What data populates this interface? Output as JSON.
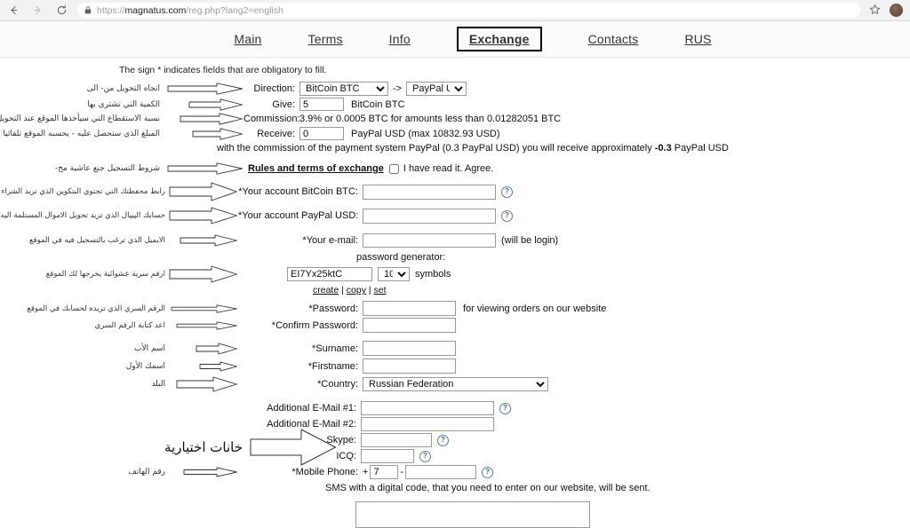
{
  "browser": {
    "back_icon": "back-arrow-icon",
    "forward_icon": "forward-arrow-icon",
    "reload_icon": "reload-icon",
    "lock_icon": "lock-icon",
    "url_scheme": "https://",
    "url_domain": "magnatus.com",
    "url_path": "/reg.php?lang2=english",
    "star_icon": "star-icon",
    "avatar_icon": "profile-avatar"
  },
  "nav": {
    "items": [
      {
        "label": "Main",
        "active": false
      },
      {
        "label": "Terms",
        "active": false
      },
      {
        "label": "Info",
        "active": false
      },
      {
        "label": "Exchange",
        "active": true
      },
      {
        "label": "Contacts",
        "active": false
      },
      {
        "label": "RUS",
        "active": false
      }
    ]
  },
  "form": {
    "obligatory_note": "The sign * indicates fields that are obligatory to fill.",
    "direction": {
      "arabic": "اتجاه التحويل من- الى",
      "label": "Direction:",
      "from_value": "BitCoin BTC",
      "arrow_text": "->",
      "to_value": "PayPal USD"
    },
    "give": {
      "arabic": "الكمية التي تشتري بها",
      "label": "Give:",
      "value": "5",
      "unit": "BitCoin BTC"
    },
    "commission": {
      "arabic": "نسبة الاستقطاع التي سيأخذها الموقع عند التحويل",
      "label": "Commission:",
      "value": "3.9% or 0.0005 BTC for amounts less than 0.01282051 BTC"
    },
    "receive": {
      "arabic": "المبلغ الذي ستحصل عليه - يحسبه الموقع تلقائيا عندما تضع السعر الذي",
      "label": "Receive:",
      "value": "0",
      "unit": "PayPal USD (max 10832.93 USD)"
    },
    "commission_note_pre": "with the commission of the payment system PayPal (0.3 PayPal USD) you will receive approximately ",
    "commission_note_bold": "-0.3",
    "commission_note_post": " PayPal USD",
    "rules": {
      "arabic": "شروط التسجيل جنع عاشية مح-",
      "link": "Rules and terms of exchange",
      "checkbox_checked": false,
      "agree_text": "I have read it. Agree."
    },
    "account_btc": {
      "arabic": "رابط محفظتك التي تحتوي البتكوين الذي تريد الشراء به",
      "label": "*Your account BitCoin BTC:",
      "value": "",
      "help_icon": "help-icon"
    },
    "account_paypal": {
      "arabic": "حسابك الپيپال الذي تريد تحويل الاموال المستلمة اليه",
      "label": "*Your account PayPal USD:",
      "value": "",
      "help_icon": "help-icon"
    },
    "email": {
      "arabic": "الايميل الذي ترغب بالتسجيل فيه في الموقع",
      "label": "*Your e-mail:",
      "value": "",
      "hint": "(will be login)"
    },
    "password_generator": {
      "title": "password generator:",
      "arabic": "ارقم سرية عشوائية يخرجها لك الموقع",
      "value": "EI7Yx25ktC",
      "symbols_count": "10",
      "symbols_label": "symbols",
      "create_link": "create",
      "copy_link": "copy",
      "set_link": "set",
      "separator": "|"
    },
    "password": {
      "arabic": "الرقم السري الذي تريده لحسابك في الموقع",
      "label": "*Password:",
      "value": "",
      "hint": "for viewing orders on our website"
    },
    "confirm_password": {
      "arabic": "اعد كتابة الرقم السري",
      "label": "*Confirm Password:",
      "value": ""
    },
    "surname": {
      "arabic": "اسم الأب",
      "label": "*Surname:",
      "value": ""
    },
    "firstname": {
      "arabic": "اسمك الأول",
      "label": "*Firstname:",
      "value": ""
    },
    "country": {
      "arabic": "البلد",
      "label": "*Country:",
      "value": "Russian Federation"
    },
    "optional_section_arabic": "خانات اختيارية",
    "additional_email_1": {
      "label": "Additional E-Mail #1:",
      "value": "",
      "help_icon": "help-icon"
    },
    "additional_email_2": {
      "label": "Additional E-Mail #2:",
      "value": ""
    },
    "skype": {
      "label": "Skype:",
      "value": "",
      "help_icon": "help-icon"
    },
    "icq": {
      "label": "ICQ:",
      "value": "",
      "help_icon": "help-icon"
    },
    "mobile_phone": {
      "arabic": "رقم الهاتف",
      "label": "*Mobile Phone:",
      "plus": "+",
      "code_value": "7",
      "dash": "-",
      "number_value": "",
      "help_icon": "help-icon"
    },
    "sms_note": "SMS with a digital code, that you need to enter on our website, will be sent."
  }
}
